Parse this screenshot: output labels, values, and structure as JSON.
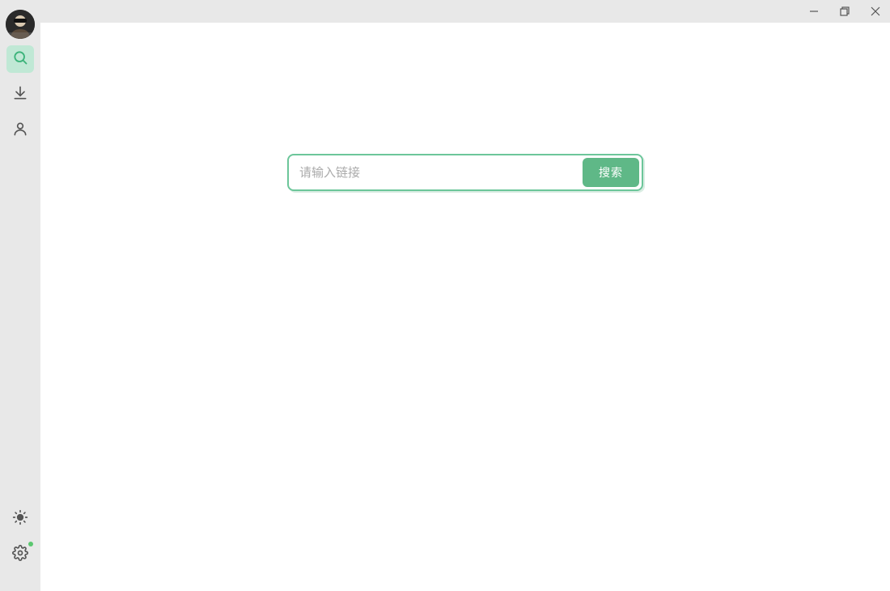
{
  "titlebar": {
    "minimize": "minimize",
    "maximize": "maximize",
    "close": "close"
  },
  "sidebar": {
    "items": [
      {
        "name": "search",
        "active": true
      },
      {
        "name": "download",
        "active": false
      },
      {
        "name": "user",
        "active": false
      }
    ],
    "bottom": [
      {
        "name": "brightness",
        "active": false
      },
      {
        "name": "settings",
        "active": false,
        "notification": true
      }
    ]
  },
  "search": {
    "placeholder": "请输入链接",
    "button_label": "搜索",
    "value": ""
  }
}
